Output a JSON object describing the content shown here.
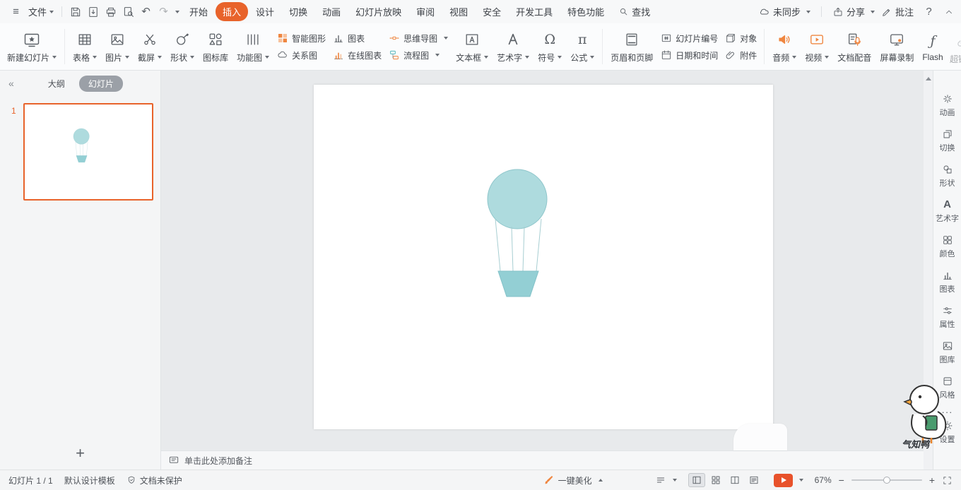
{
  "glyphs": {
    "hamburger": "≡",
    "undo": "↶",
    "redo": "↷",
    "question": "?",
    "omega": "Ω",
    "pi": "π",
    "flash_f": "ƒ",
    "a": "A",
    "plus": "+",
    "minus": "−",
    "collapse_left": "«",
    "ellipsis": "···"
  },
  "colors": {
    "accent_orange": "#e8632b",
    "play_button": "#e8522b",
    "slides_tab_pill": "#9ba0a7",
    "balloon_fill": "#aedbde",
    "balloon_stroke": "#8fc6cb",
    "rope_stroke": "#a7ced2",
    "basket_fill": "#93cfd4",
    "basket_stroke": "#83c2c8"
  },
  "menubar": {
    "file": "文件",
    "tabs": [
      "开始",
      "插入",
      "设计",
      "切换",
      "动画",
      "幻灯片放映",
      "审阅",
      "视图",
      "安全",
      "开发工具",
      "特色功能"
    ],
    "active_tab": "插入",
    "search": "查找",
    "sync": "未同步",
    "share": "分享",
    "comment": "批注"
  },
  "ribbon": {
    "new_slide": "新建幻灯片",
    "table": "表格",
    "picture": "图片",
    "screenshot": "截屏",
    "shapes": "形状",
    "icon_library": "图标库",
    "function_diagram": "功能图",
    "smart_graphics": "智能图形",
    "relation_diagram": "关系图",
    "chart": "图表",
    "online_chart": "在线图表",
    "mind_map": "思维导图",
    "flowchart": "流程图",
    "text_box": "文本框",
    "word_art": "艺术字",
    "symbol": "符号",
    "formula": "公式",
    "header_footer": "页眉和页脚",
    "slide_number": "幻灯片编号",
    "date_time": "日期和时间",
    "object": "对象",
    "attachment": "附件",
    "audio": "音频",
    "video": "视频",
    "doc_dubbing": "文档配音",
    "screen_record": "屏幕录制",
    "flash": "Flash",
    "hyperlink": "超链接"
  },
  "left_panel": {
    "outline_tab": "大纲",
    "slides_tab": "幻灯片",
    "slide_number": "1"
  },
  "canvas": {
    "notes_placeholder": "单击此处添加备注"
  },
  "right_sidebar": {
    "items": [
      "动画",
      "切换",
      "形状",
      "艺术字",
      "颜色",
      "图表",
      "属性",
      "图库",
      "风格",
      "设置"
    ],
    "mascot_text": "气知鸭"
  },
  "statusbar": {
    "slide_counter": "幻灯片 1 / 1",
    "template": "默认设计模板",
    "protection": "文档未保护",
    "beautify": "一键美化",
    "zoom": "67%"
  }
}
